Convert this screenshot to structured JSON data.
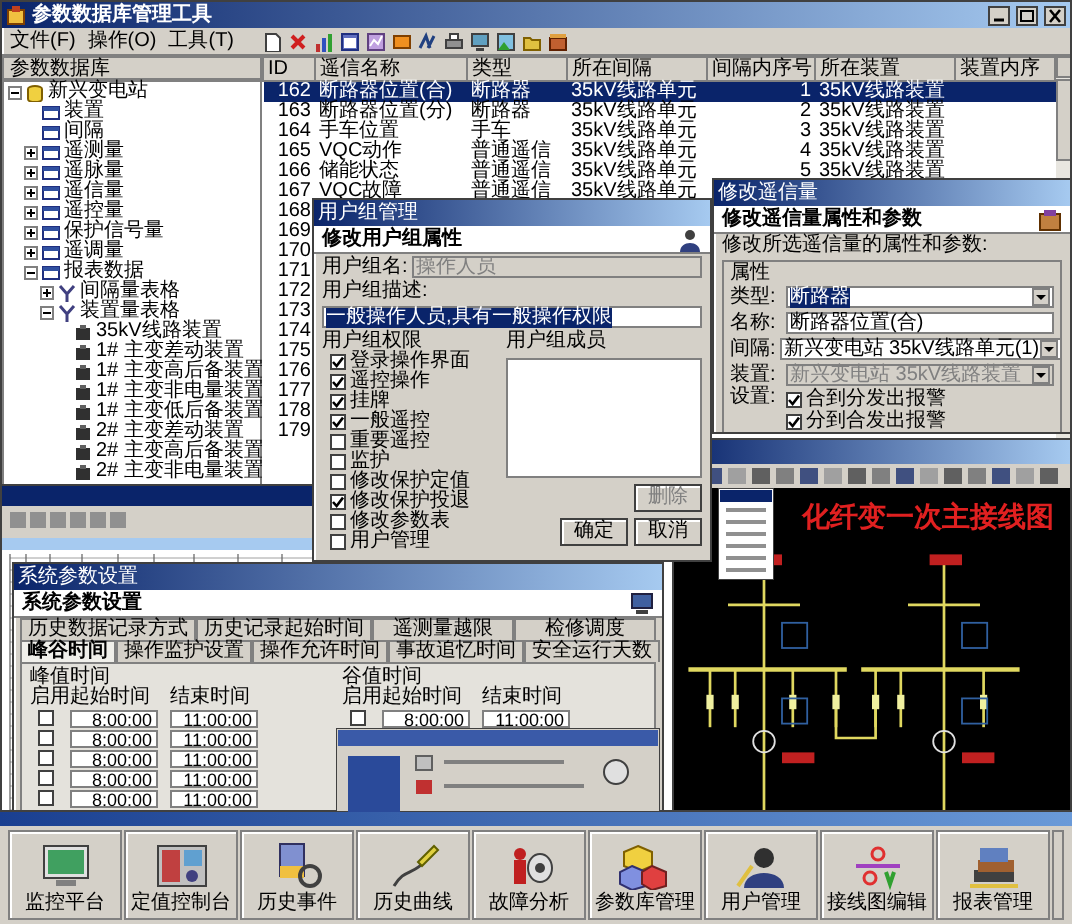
{
  "main_window": {
    "title": "参数数据库管理工具",
    "menus": [
      "文件(F)",
      "操作(O)",
      "工具(T)"
    ],
    "panel_title": "参数数据库",
    "tree": [
      {
        "label": "新兴变电站",
        "expanded": true,
        "children": [
          {
            "label": "装置"
          },
          {
            "label": "间隔"
          },
          {
            "label": "遥测量",
            "expanded": false
          },
          {
            "label": "遥脉量",
            "expanded": false
          },
          {
            "label": "遥信量",
            "expanded": false
          },
          {
            "label": "遥控量",
            "expanded": false
          },
          {
            "label": "保护信号量",
            "expanded": false
          },
          {
            "label": "遥调量",
            "expanded": false
          },
          {
            "label": "报表数据",
            "expanded": true,
            "children": [
              {
                "label": "间隔量表格",
                "expanded": false
              },
              {
                "label": "装置量表格",
                "expanded": true,
                "children": [
                  {
                    "label": "35kV线路装置"
                  },
                  {
                    "label": "1# 主变差动装置"
                  },
                  {
                    "label": "1# 主变高后备装置"
                  },
                  {
                    "label": "1# 主变非电量装置"
                  },
                  {
                    "label": "1# 主变低后备装置"
                  },
                  {
                    "label": "2# 主变差动装置"
                  },
                  {
                    "label": "2# 主变高后备装置"
                  },
                  {
                    "label": "2# 主变非电量装置"
                  }
                ]
              }
            ]
          }
        ]
      }
    ],
    "table": {
      "columns": [
        "ID",
        "遥信名称",
        "类型",
        "所在间隔",
        "间隔内序号",
        "所在装置",
        "装置内序"
      ],
      "rows": [
        {
          "cells": [
            "162",
            "断路器位置(合)",
            "断路器",
            "35kV线路单元",
            "1",
            "35kV线路装置"
          ],
          "selected": true
        },
        {
          "cells": [
            "163",
            "断路器位置(分)",
            "断路器",
            "35kV线路单元",
            "2",
            "35kV线路装置"
          ],
          "selected": false
        },
        {
          "cells": [
            "164",
            "手车位置",
            "手车",
            "35kV线路单元",
            "3",
            "35kV线路装置"
          ],
          "selected": false
        },
        {
          "cells": [
            "165",
            "VQC动作",
            "普通遥信",
            "35kV线路单元",
            "4",
            "35kV线路装置"
          ],
          "selected": false
        },
        {
          "cells": [
            "166",
            "储能状态",
            "普通遥信",
            "35kV线路单元",
            "5",
            "35kV线路装置"
          ],
          "selected": false
        },
        {
          "cells": [
            "167",
            "VQC故障",
            "普通遥信",
            "35kV线路单元"
          ],
          "selected": false
        },
        {
          "cells": [
            "168"
          ],
          "selected": false
        },
        {
          "cells": [
            "169"
          ],
          "selected": false
        },
        {
          "cells": [
            "170"
          ],
          "selected": false
        },
        {
          "cells": [
            "171"
          ],
          "selected": false
        },
        {
          "cells": [
            "172"
          ],
          "selected": false
        },
        {
          "cells": [
            "173"
          ],
          "selected": false
        },
        {
          "cells": [
            "174"
          ],
          "selected": false
        },
        {
          "cells": [
            "175"
          ],
          "selected": false
        },
        {
          "cells": [
            "176"
          ],
          "selected": false
        },
        {
          "cells": [
            "177"
          ],
          "selected": false
        },
        {
          "cells": [
            "178"
          ],
          "selected": false
        },
        {
          "cells": [
            "179"
          ],
          "selected": false
        }
      ]
    }
  },
  "user_group_dialog": {
    "title": "用户组管理",
    "heading": "修改用户组属性",
    "fields": [
      {
        "label": "用户组名:",
        "value": "操作人员",
        "disabled": true,
        "highlighted": false
      },
      {
        "label": "用户组描述:",
        "value": "一般操作人员,具有一般操作权限",
        "disabled": false,
        "highlighted": true
      }
    ],
    "permissions_label": "用户组权限",
    "permissions": [
      {
        "label": "登录操作界面",
        "checked": true
      },
      {
        "label": "遥控操作",
        "checked": true
      },
      {
        "label": "挂牌",
        "checked": true
      },
      {
        "label": "一般遥控",
        "checked": true
      },
      {
        "label": "重要遥控",
        "checked": false
      },
      {
        "label": "监护",
        "checked": false
      },
      {
        "label": "修改保护定值",
        "checked": false
      },
      {
        "label": "修改保护投退",
        "checked": true
      },
      {
        "label": "修改参数表",
        "checked": false
      },
      {
        "label": "用户管理",
        "checked": false
      }
    ],
    "members_label": "用户组成员",
    "buttons": [
      {
        "label": "删除",
        "disabled": true
      },
      {
        "label": "确定",
        "disabled": false
      },
      {
        "label": "取消",
        "disabled": false
      }
    ]
  },
  "signal_dialog": {
    "title": "修改遥信量",
    "heading": "修改遥信量属性和参数",
    "prompt": "修改所选遥信量的属性和参数:",
    "group": "属性",
    "fields": [
      {
        "label": "类型:",
        "value": "断路器",
        "kind": "select",
        "disabled": false,
        "highlighted": true
      },
      {
        "label": "名称:",
        "value": "断路器位置(合)",
        "kind": "text",
        "disabled": false,
        "highlighted": false
      },
      {
        "label": "间隔:",
        "value": "新兴变电站 35kV线路单元(1)",
        "kind": "select",
        "disabled": false,
        "highlighted": false
      },
      {
        "label": "装置:",
        "value": "新兴变电站 35kV线路装置",
        "kind": "select",
        "disabled": true,
        "highlighted": false
      }
    ],
    "alarm_label": "设置:",
    "alarms": [
      {
        "label": "合到分发出报警",
        "checked": true
      },
      {
        "label": "分到合发出报警",
        "checked": true
      }
    ]
  },
  "diagram_window": {
    "canvas_title": "化纤变一次主接线图"
  },
  "settings_dialog": {
    "title": "系统参数设置",
    "heading": "系统参数设置",
    "tab_rows": [
      [
        {
          "label": "历史数据记录方式",
          "selected": false
        },
        {
          "label": "历史记录起始时间",
          "selected": false
        },
        {
          "label": "遥测量越限",
          "selected": false
        },
        {
          "label": "检修调度",
          "selected": false
        }
      ],
      [
        {
          "label": "峰谷时间",
          "selected": true
        },
        {
          "label": "操作监护设置",
          "selected": false
        },
        {
          "label": "操作允许时间",
          "selected": false
        },
        {
          "label": "事故追忆时间",
          "selected": false
        },
        {
          "label": "安全运行天数",
          "selected": false
        }
      ]
    ],
    "groups": [
      {
        "title": "峰值时间",
        "columns": [
          "启用",
          "起始时间",
          "结束时间"
        ],
        "rows": [
          {
            "enabled": false,
            "start": "8:00:00",
            "end": "11:00:00"
          },
          {
            "enabled": false,
            "start": "8:00:00",
            "end": "11:00:00"
          },
          {
            "enabled": false,
            "start": "8:00:00",
            "end": "11:00:00"
          },
          {
            "enabled": false,
            "start": "8:00:00",
            "end": "11:00:00"
          },
          {
            "enabled": false,
            "start": "8:00:00",
            "end": "11:00:00"
          }
        ]
      },
      {
        "title": "谷值时间",
        "columns": [
          "启用",
          "起始时间",
          "结束时间"
        ],
        "rows": [
          {
            "enabled": false,
            "start": "8:00:00",
            "end": "11:00:00"
          }
        ]
      }
    ]
  },
  "launcher": [
    {
      "label": "监控平台"
    },
    {
      "label": "定值控制台"
    },
    {
      "label": "历史事件"
    },
    {
      "label": "历史曲线"
    },
    {
      "label": "故障分析"
    },
    {
      "label": "参数库管理"
    },
    {
      "label": "用户管理"
    },
    {
      "label": "接线图编辑"
    },
    {
      "label": "报表管理"
    }
  ]
}
